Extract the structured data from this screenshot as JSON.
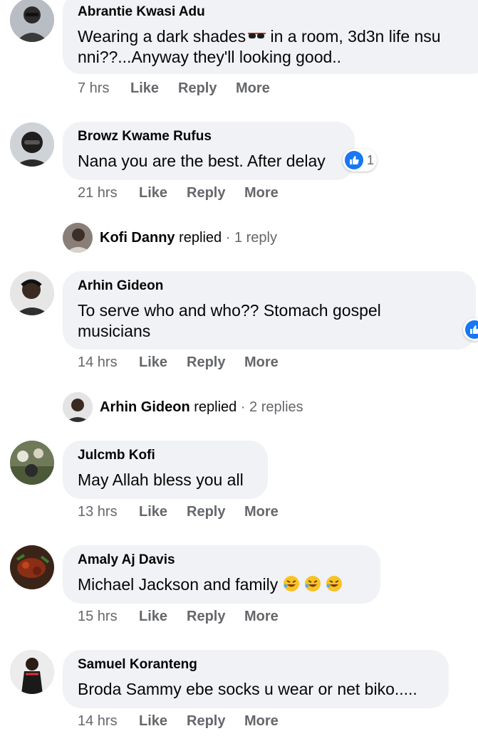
{
  "comments": [
    {
      "name": "Abrantie Kwasi Adu",
      "line1": "Wearing a dark shades",
      "emoji": "sunglasses-emoji",
      "line1b": " in a room, 3d3n life nsu",
      "line2": "nni??...Anyway they'll looking good..",
      "time": "7 hrs"
    },
    {
      "name": "Browz Kwame Rufus",
      "line1": "Nana you are the best. After delay",
      "time": "21 hrs",
      "reaction": {
        "icon": "thumbs-up-icon",
        "count": "1"
      }
    },
    {
      "name": "Arhin Gideon",
      "line1": "To serve who and who?? Stomach gospel",
      "line2": "musicians",
      "time": "14 hrs"
    },
    {
      "name": "Julcmb Kofi",
      "line1": "May Allah bless you all",
      "time": "13 hrs"
    },
    {
      "name": "Amaly Aj Davis",
      "line1": "Michael Jackson and family ",
      "emoji": "rolling-on-floor-laughing-emoji",
      "time": "15 hrs"
    },
    {
      "name": "Samuel Koranteng",
      "line1": "Broda Sammy ebe socks u wear or net biko.....",
      "time": "14 hrs"
    }
  ],
  "actions": {
    "like": "Like",
    "reply": "Reply",
    "more": "More"
  },
  "replies": [
    {
      "name": "Kofi Danny",
      "verb": " replied",
      "count": " · 1 reply"
    },
    {
      "name": "Arhin Gideon",
      "verb": " replied",
      "count": " · 2 replies"
    }
  ],
  "colors": {
    "bubble": "#f0f2f5",
    "meta": "#65676b",
    "like_blue": "#1877f2"
  }
}
